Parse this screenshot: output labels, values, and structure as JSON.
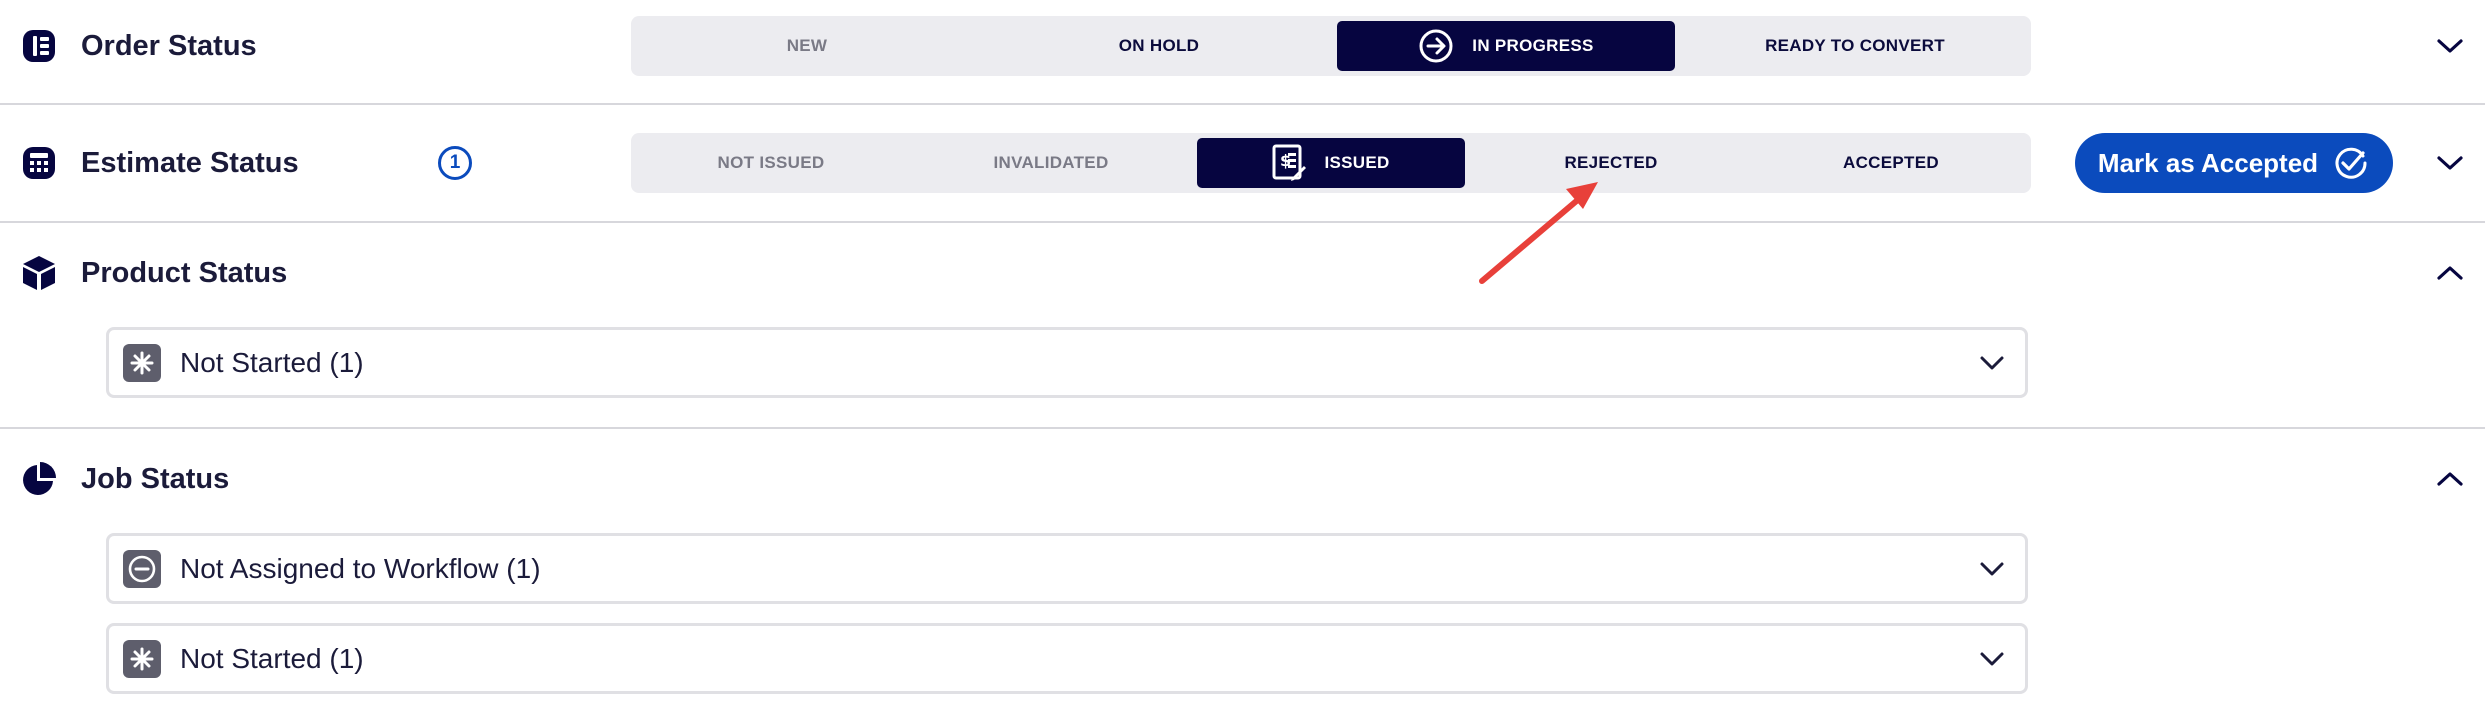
{
  "order_status": {
    "title": "Order Status",
    "icon": "order-status-icon",
    "steps": [
      {
        "label": "NEW",
        "state": "muted"
      },
      {
        "label": "ON HOLD",
        "state": "normal"
      },
      {
        "label": "IN PROGRESS",
        "state": "active",
        "icon": "arrow-right-circle-icon"
      },
      {
        "label": "READY TO CONVERT",
        "state": "normal"
      }
    ]
  },
  "estimate_status": {
    "title": "Estimate Status",
    "icon": "calculator-icon",
    "count": "1",
    "steps": [
      {
        "label": "NOT ISSUED",
        "state": "muted"
      },
      {
        "label": "INVALIDATED",
        "state": "muted"
      },
      {
        "label": "ISSUED",
        "state": "active",
        "icon": "estimate-document-icon"
      },
      {
        "label": "REJECTED",
        "state": "normal"
      },
      {
        "label": "ACCEPTED",
        "state": "normal"
      }
    ],
    "action_button": "Mark as Accepted"
  },
  "product_status": {
    "title": "Product Status",
    "icon": "cube-icon",
    "items": [
      {
        "label": "Not Started (1)",
        "icon": "asterisk-icon"
      }
    ]
  },
  "job_status": {
    "title": "Job Status",
    "icon": "pie-chart-icon",
    "items": [
      {
        "label": "Not Assigned to Workflow (1)",
        "icon": "minus-circle-icon"
      },
      {
        "label": "Not Started (1)",
        "icon": "asterisk-icon"
      }
    ]
  },
  "colors": {
    "navy": "#060540",
    "brand_blue": "#0b4bbd",
    "segment_bg": "#ececf0",
    "annotation_red": "#e8403a"
  }
}
